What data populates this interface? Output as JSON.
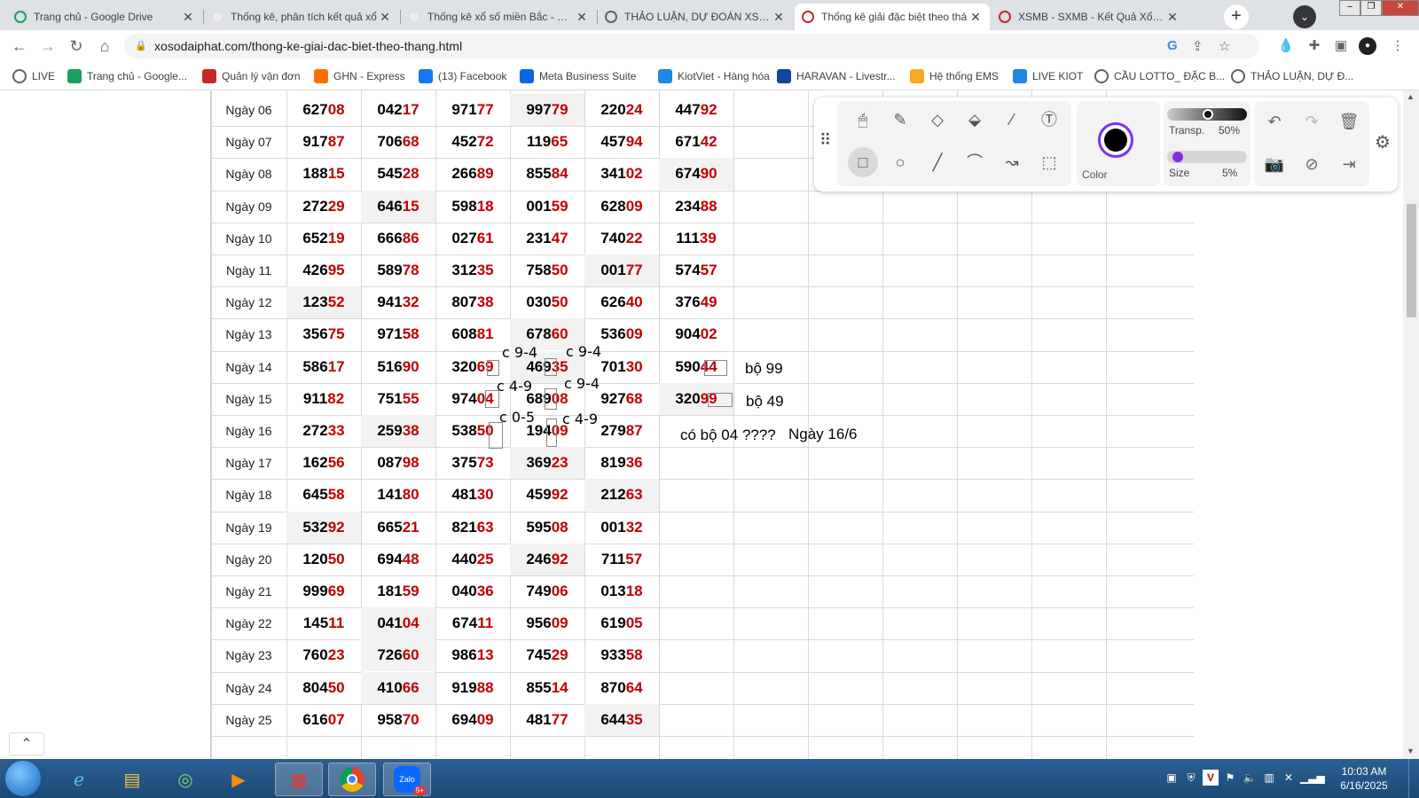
{
  "browser": {
    "tabs": [
      {
        "title": "Trang chủ - Google Drive",
        "icon": "google-drive-icon",
        "active": false
      },
      {
        "title": "Thống kê, phân tích kết quả xổ",
        "icon": "rbk-icon",
        "active": false
      },
      {
        "title": "Thống kê xổ số miền Bắc - Rồn",
        "icon": "rbk-icon",
        "active": false
      },
      {
        "title": "THẢO LUẬN, DỰ ĐOÁN XSMB",
        "icon": "globe-icon",
        "active": false
      },
      {
        "title": "Thống kê giải đặc biệt theo thá",
        "icon": "xosodaiphat-icon",
        "active": true
      },
      {
        "title": "XSMB - SXMB - Kết Quả Xổ Số",
        "icon": "xosodaiphat-icon",
        "active": false
      }
    ],
    "new_tab_label": "+",
    "close_glyph": "✕",
    "url": "xosodaiphat.com/thong-ke-giai-dac-biet-theo-thang.html",
    "bookmarks": [
      {
        "label": "LIVE",
        "icon": "globe-icon",
        "color": "#5f6368"
      },
      {
        "label": "Trang chủ - Google...",
        "icon": "google-drive-icon",
        "color": "#1aa260"
      },
      {
        "label": "Quản lý vận đơn",
        "icon": "red-square-icon",
        "color": "#c62828"
      },
      {
        "label": "GHN - Express",
        "icon": "ghn-icon",
        "color": "#ff6f00"
      },
      {
        "label": "(13) Facebook",
        "icon": "facebook-icon",
        "color": "#1877f2"
      },
      {
        "label": "Meta Business Suite",
        "icon": "meta-icon",
        "color": "#0668e1"
      },
      {
        "label": "KiotViet - Hàng hóa",
        "icon": "kiotviet-icon",
        "color": "#1e88e5"
      },
      {
        "label": "HARAVAN - Livestr...",
        "icon": "haravan-icon",
        "color": "#0d47a1"
      },
      {
        "label": "Hệ thống EMS",
        "icon": "ems-icon",
        "color": "#f9a825"
      },
      {
        "label": "LIVE KIOT",
        "icon": "kiotviet-icon",
        "color": "#1e88e5"
      },
      {
        "label": "CẦU LOTTO_ ĐẶC B...",
        "icon": "globe-icon",
        "color": "#5f6368"
      },
      {
        "label": "THẢO LUẬN, DỰ Đ...",
        "icon": "globe-icon",
        "color": "#5f6368"
      }
    ]
  },
  "table": {
    "rows": [
      {
        "day": "Ngày 06",
        "values": [
          [
            "627",
            "08"
          ],
          [
            "042",
            "17"
          ],
          [
            "971",
            "77"
          ],
          [
            "997",
            "79"
          ],
          [
            "220",
            "24"
          ],
          [
            "447",
            "92"
          ]
        ]
      },
      {
        "day": "Ngày 07",
        "values": [
          [
            "917",
            "87"
          ],
          [
            "706",
            "68"
          ],
          [
            "452",
            "72"
          ],
          [
            "119",
            "65"
          ],
          [
            "457",
            "94"
          ],
          [
            "671",
            "42"
          ]
        ]
      },
      {
        "day": "Ngày 08",
        "values": [
          [
            "188",
            "15"
          ],
          [
            "545",
            "28"
          ],
          [
            "266",
            "89"
          ],
          [
            "855",
            "84"
          ],
          [
            "341",
            "02"
          ],
          [
            "674",
            "90"
          ]
        ]
      },
      {
        "day": "Ngày 09",
        "values": [
          [
            "272",
            "29"
          ],
          [
            "646",
            "15"
          ],
          [
            "598",
            "18"
          ],
          [
            "001",
            "59"
          ],
          [
            "628",
            "09"
          ],
          [
            "234",
            "88"
          ]
        ]
      },
      {
        "day": "Ngày 10",
        "values": [
          [
            "652",
            "19"
          ],
          [
            "666",
            "86"
          ],
          [
            "027",
            "61"
          ],
          [
            "231",
            "47"
          ],
          [
            "740",
            "22"
          ],
          [
            "111",
            "39"
          ]
        ]
      },
      {
        "day": "Ngày 11",
        "values": [
          [
            "426",
            "95"
          ],
          [
            "589",
            "78"
          ],
          [
            "312",
            "35"
          ],
          [
            "758",
            "50"
          ],
          [
            "001",
            "77"
          ],
          [
            "574",
            "57"
          ]
        ]
      },
      {
        "day": "Ngày 12",
        "values": [
          [
            "123",
            "52"
          ],
          [
            "941",
            "32"
          ],
          [
            "807",
            "38"
          ],
          [
            "030",
            "50"
          ],
          [
            "626",
            "40"
          ],
          [
            "376",
            "49"
          ]
        ]
      },
      {
        "day": "Ngày 13",
        "values": [
          [
            "356",
            "75"
          ],
          [
            "971",
            "58"
          ],
          [
            "608",
            "81"
          ],
          [
            "678",
            "60"
          ],
          [
            "536",
            "09"
          ],
          [
            "904",
            "02"
          ]
        ]
      },
      {
        "day": "Ngày 14",
        "values": [
          [
            "586",
            "17"
          ],
          [
            "516",
            "90"
          ],
          [
            "320",
            "69"
          ],
          [
            "469",
            "35"
          ],
          [
            "701",
            "30"
          ],
          [
            "590",
            "44"
          ]
        ]
      },
      {
        "day": "Ngày 15",
        "values": [
          [
            "911",
            "82"
          ],
          [
            "751",
            "55"
          ],
          [
            "974",
            "04"
          ],
          [
            "689",
            "08"
          ],
          [
            "927",
            "68"
          ],
          [
            "320",
            "99"
          ]
        ]
      },
      {
        "day": "Ngày 16",
        "values": [
          [
            "272",
            "33"
          ],
          [
            "259",
            "38"
          ],
          [
            "538",
            "50"
          ],
          [
            "194",
            "09"
          ],
          [
            "279",
            "87"
          ]
        ]
      },
      {
        "day": "Ngày 17",
        "values": [
          [
            "162",
            "56"
          ],
          [
            "087",
            "98"
          ],
          [
            "375",
            "73"
          ],
          [
            "369",
            "23"
          ],
          [
            "819",
            "36"
          ]
        ]
      },
      {
        "day": "Ngày 18",
        "values": [
          [
            "645",
            "58"
          ],
          [
            "141",
            "80"
          ],
          [
            "481",
            "30"
          ],
          [
            "459",
            "92"
          ],
          [
            "212",
            "63"
          ]
        ]
      },
      {
        "day": "Ngày 19",
        "values": [
          [
            "532",
            "92"
          ],
          [
            "665",
            "21"
          ],
          [
            "821",
            "63"
          ],
          [
            "595",
            "08"
          ],
          [
            "001",
            "32"
          ]
        ]
      },
      {
        "day": "Ngày 20",
        "values": [
          [
            "120",
            "50"
          ],
          [
            "694",
            "48"
          ],
          [
            "440",
            "25"
          ],
          [
            "246",
            "92"
          ],
          [
            "711",
            "57"
          ]
        ]
      },
      {
        "day": "Ngày 21",
        "values": [
          [
            "999",
            "69"
          ],
          [
            "181",
            "59"
          ],
          [
            "040",
            "36"
          ],
          [
            "749",
            "06"
          ],
          [
            "013",
            "18"
          ]
        ]
      },
      {
        "day": "Ngày 22",
        "values": [
          [
            "145",
            "11"
          ],
          [
            "041",
            "04"
          ],
          [
            "674",
            "11"
          ],
          [
            "956",
            "09"
          ],
          [
            "619",
            "05"
          ]
        ]
      },
      {
        "day": "Ngày 23",
        "values": [
          [
            "760",
            "23"
          ],
          [
            "726",
            "60"
          ],
          [
            "986",
            "13"
          ],
          [
            "745",
            "29"
          ],
          [
            "933",
            "58"
          ]
        ]
      },
      {
        "day": "Ngày 24",
        "values": [
          [
            "804",
            "50"
          ],
          [
            "410",
            "66"
          ],
          [
            "919",
            "88"
          ],
          [
            "855",
            "14"
          ],
          [
            "870",
            "64"
          ]
        ]
      },
      {
        "day": "Ngày 25",
        "values": [
          [
            "616",
            "07"
          ],
          [
            "958",
            "70"
          ],
          [
            "694",
            "09"
          ],
          [
            "481",
            "77"
          ],
          [
            "644",
            "35"
          ]
        ]
      }
    ]
  },
  "annotations": {
    "c94_a": "c 9-4",
    "c94_b": "c 9-4",
    "c49_a": "c 4-9",
    "c94_c": "c 9-4",
    "c05": "c 0-5",
    "c49_b": "c 4-9",
    "bo99": "bộ 99",
    "bo49": "bộ 49",
    "bo04": "có bộ 04 ????",
    "ngay16": "Ngày 16/6"
  },
  "draw_panel": {
    "color_label": "Color",
    "transp_label": "Transp.",
    "transp_value": "50%",
    "transp_fraction": 0.5,
    "size_label": "Size",
    "size_value": "5%",
    "size_fraction": 0.05,
    "selected_color": "#000000",
    "accent": "#7b2ff7"
  },
  "taskbar": {
    "time": "10:03 AM",
    "date": "6/16/2025",
    "zalo_badge": "5+",
    "zalo_label": "Zalo"
  }
}
